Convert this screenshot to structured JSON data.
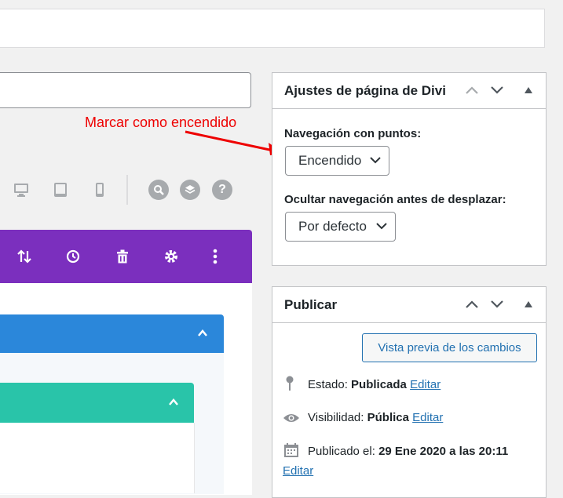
{
  "annotation": {
    "text": "Marcar como encendido"
  },
  "divi_box": {
    "title": "Ajustes de página de Divi",
    "dot_nav_label": "Navegación con puntos:",
    "dot_nav_value": "Encendido",
    "hide_nav_label": "Ocultar navegación antes de desplazar:",
    "hide_nav_value": "Por defecto"
  },
  "publish_box": {
    "title": "Publicar",
    "preview_button": "Vista previa de los cambios",
    "status_label": "Estado:",
    "status_value": "Publicada",
    "status_edit": "Editar",
    "visibility_label": "Visibilidad:",
    "visibility_value": "Pública",
    "visibility_edit": "Editar",
    "published_label": "Publicado el:",
    "published_value": "29 Ene 2020 a las 20:11",
    "published_edit": "Editar"
  },
  "toolbar": {
    "help_glyph": "?"
  },
  "colors": {
    "builder_purple": "#7b2fbe",
    "section_blue": "#2b87da",
    "row_teal": "#29c4a9",
    "annotation_red": "#e00000",
    "link_blue": "#2271b1"
  }
}
